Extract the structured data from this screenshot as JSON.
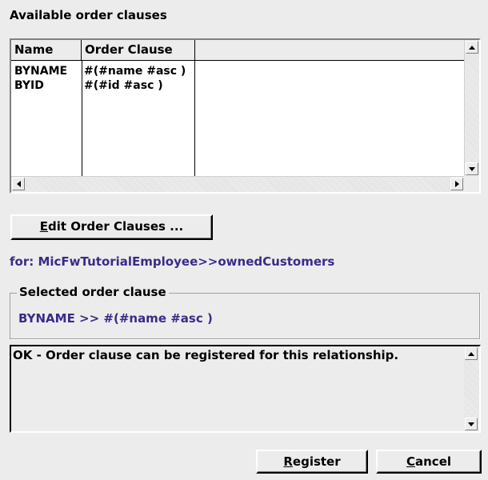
{
  "title": "Available order clauses",
  "table": {
    "columns": [
      "Name",
      "Order Clause"
    ],
    "rows": [
      {
        "name": "BYNAME",
        "clause": "#(#name #asc )"
      },
      {
        "name": "BYID",
        "clause": "#(#id #asc )"
      }
    ]
  },
  "edit_button": {
    "accel": "E",
    "rest": "dit Order Clauses ..."
  },
  "for_label": "for: MicFwTutorialEmployee>>ownedCustomers",
  "selected_group": {
    "legend": "Selected order clause",
    "value": "BYNAME >> #(#name #asc )"
  },
  "message": "OK - Order clause can be registered for this relationship.",
  "buttons": {
    "register": {
      "accel": "R",
      "rest": "egister"
    },
    "cancel": {
      "accel": "C",
      "rest": "ancel"
    }
  },
  "icons": {
    "scroll_up": "arrow-up-icon",
    "scroll_down": "arrow-down-icon",
    "scroll_left": "arrow-left-icon",
    "scroll_right": "arrow-right-icon"
  }
}
